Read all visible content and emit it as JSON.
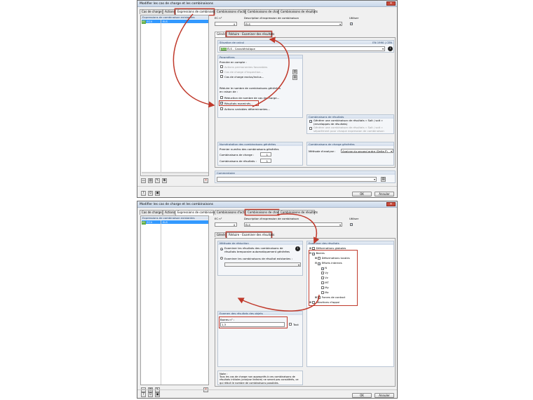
{
  "window_title": "Modifier les cas de charge et les combinaisons",
  "tabs": [
    "Cas de charge",
    "Actions",
    "Expressions de combinaison",
    "Combinaisons d'actions",
    "Combinaisons de charge",
    "Combinaisons de résultats"
  ],
  "left_list": {
    "header": "Expressions de combinaison existantes",
    "row_badge": "EC",
    "row_id": "EC4",
    "row_name": "ELS"
  },
  "ec_no_label": "EC n°",
  "ec_no_value": "4",
  "description_label": "Description d'expression de combinaison",
  "description_value": "ÉLS",
  "use_label": "Utiliser",
  "subtabs": {
    "general": "Général",
    "reduce": "Réduire - Examiner des résultats"
  },
  "top": {
    "situation": {
      "header": "Situation de calcul",
      "norm": "EN 1990 | CEN",
      "badge": "ÉLS",
      "value": "ÉLS - Caractéristique"
    },
    "parameters": {
      "header": "Paramètres",
      "take_into_account": "Prendre en compte :",
      "favorable": "Actions permanentes favorables",
      "inspection": "Cas de charge d'inspection...",
      "exclusive": "Cas de charge exclus/inclus...",
      "reduce_text": "Réduire le nombre de combinaisons générées en raison de :",
      "reduce_lc": "Réduction de nombre de cas de charge...",
      "examined_results": "Résultats examinés...",
      "decisive": "Actions variables déterminantes..."
    },
    "result_combos": {
      "header": "Combinaisons de résultats",
      "generate": "Générer une combinaison de résultats « Soit / soit » (enveloppes de résultats)",
      "generate_extra": "Générer une combinaison de résultats « Soit / soit » séparément pour chaque expression de combinaison"
    },
    "numbering": {
      "header": "Numérotation des combinaisons générées",
      "first_label": "Premier numéro des combinaisons générées",
      "lc_label": "Combinaisons de charge :",
      "lc_value": "1",
      "rc_label": "Combinaisons de résultats :",
      "rc_value": "1"
    },
    "generated": {
      "header": "Combinaisons de charge générées",
      "method_label": "Méthode d'analyse :",
      "method_value": "Analyse du second ordre (Delta P)"
    },
    "comment": "Commentaire",
    "ok": "OK",
    "cancel": "Annuler"
  },
  "bottom": {
    "method": {
      "header": "Méthode de réduction",
      "opt1": "Examiner les résultats des combinaisons de résultats temporaire automatiquement générées",
      "opt2": "Examiner les combinaisons de résultat existantes :"
    },
    "objects": {
      "header": "Examen des résultats des objets",
      "bars_label": "Barres n° :",
      "bars_value": "1,3",
      "all_label": "Tout"
    },
    "note": {
      "title": "Note :",
      "text": "Tous les cas de charge non appropriés à ces combinaisons de résultats initiales (analyse linéaire) ne seront pas considérés, ce qui réduit le nombre de combinaisons possibles."
    },
    "examined": {
      "header": "Examiner des résultats",
      "items": [
        "Déformations globales",
        "Barres",
        "Déformations locales",
        "Efforts internes",
        "N",
        "Vy",
        "Vz",
        "MT",
        "My",
        "Mz",
        "Forces de contact",
        "Réactions d'appui"
      ]
    },
    "ok": "OK",
    "cancel": "Annuler"
  },
  "colors": {
    "highlight": "#c0392b",
    "selection": "#3399ff",
    "badge": "#5eaa3e"
  }
}
